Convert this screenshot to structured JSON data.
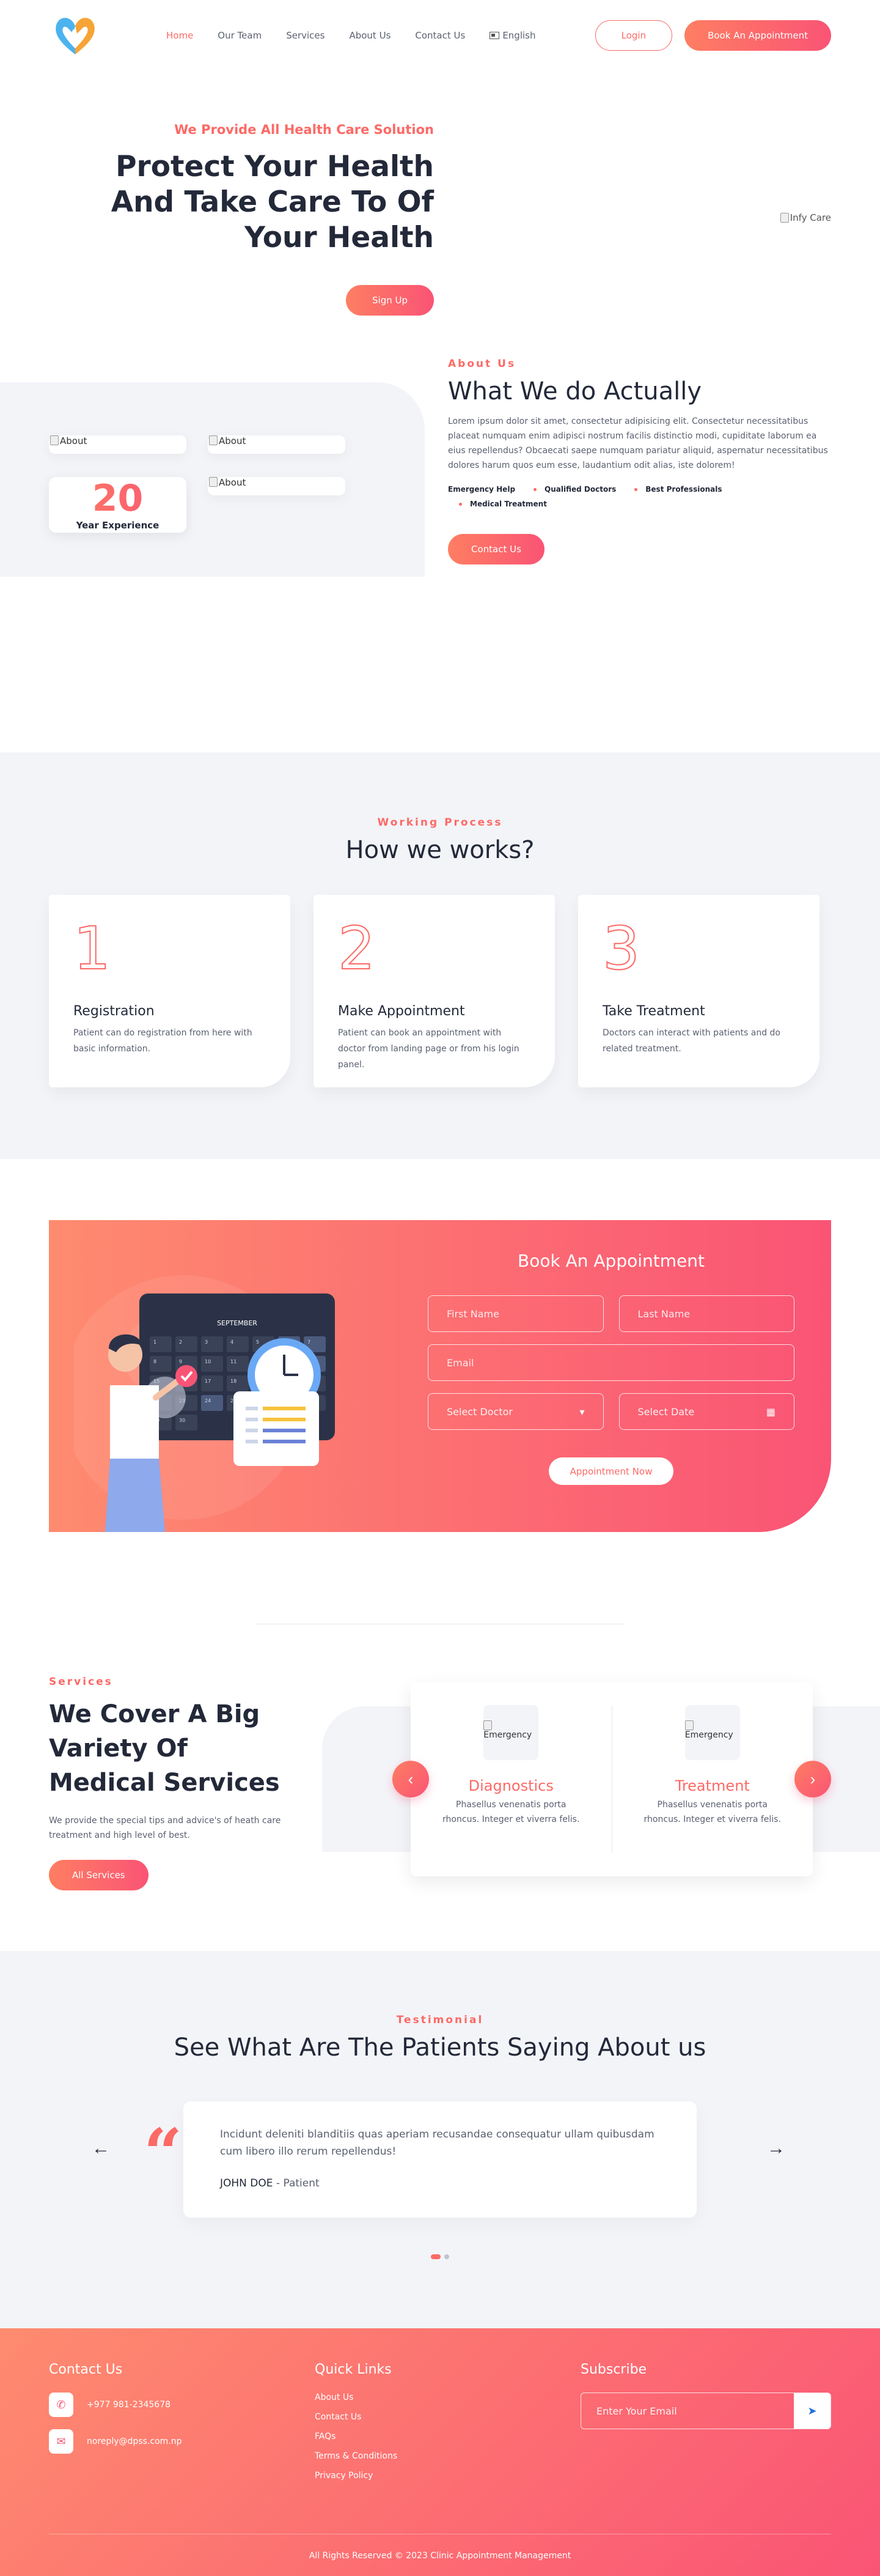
{
  "header": {
    "nav": [
      "Home",
      "Our Team",
      "Services",
      "About Us",
      "Contact Us"
    ],
    "language": "English",
    "login_label": "Login",
    "book_label": "Book An Appointment",
    "colors": {
      "accent": "#fc6a66",
      "gradient_start": "#fe7e62",
      "gradient_end": "#fa5475",
      "logo_blue": "#4cb3ef",
      "logo_orange": "#f7a437"
    }
  },
  "hero": {
    "subtitle": "We Provide All Health Care Solution",
    "title": "Protect Your Health And Take Care To Of Your Health",
    "signup_label": "Sign Up",
    "image_alt": "Infy Care"
  },
  "about": {
    "image_alt_1": "About",
    "image_alt_2": "About",
    "image_alt_3": "About",
    "experience_number": "20",
    "experience_label": "Year Experience",
    "tagline": "About Us",
    "title": "What We do Actually",
    "paragraph": "Lorem ipsum dolor sit amet, consectetur adipisicing elit. Consectetur necessitatibus placeat numquam enim adipisci nostrum facilis distinctio modi, cupiditate laborum ea eius repellendus? Obcaecati saepe numquam pariatur aliquid, aspernatur necessitatibus dolores harum quos eum esse, laudantium odit alias, iste dolorem!",
    "features": [
      "Emergency Help",
      "Qualified Doctors",
      "Best Professionals",
      "Medical Treatment"
    ],
    "contact_label": "Contact Us"
  },
  "works": {
    "tagline": "Working Process",
    "title": "How we works?",
    "steps": [
      {
        "num": "1",
        "title": "Registration",
        "desc": "Patient can do registration from here with basic information."
      },
      {
        "num": "2",
        "title": "Make Appointment",
        "desc": "Patient can book an appointment with doctor from landing page or from his login panel."
      },
      {
        "num": "3",
        "title": "Take Treatment",
        "desc": "Doctors can interact with patients and do related treatment."
      }
    ]
  },
  "appointment": {
    "title": "Book An Appointment",
    "first_name_placeholder": "First Name",
    "last_name_placeholder": "Last Name",
    "email_placeholder": "Email",
    "doctor_label": "Select Doctor",
    "date_label": "Select Date",
    "submit_label": "Appointment Now",
    "calendar_month": "SEPTEMBER",
    "calendar_days": [
      "1",
      "2",
      "3",
      "4",
      "5",
      "6",
      "7",
      "8",
      "9",
      "10",
      "11",
      "12",
      "13",
      "14",
      "15",
      "16",
      "17",
      "18",
      "19",
      "20",
      "21",
      "22",
      "23",
      "24",
      "25",
      "26",
      "27",
      "28",
      "29",
      "30"
    ]
  },
  "services": {
    "tagline": "Services",
    "title": "We Cover A Big Variety Of Medical Services",
    "paragraph": "We provide the special tips and advice's of heath care treatment and high level of best.",
    "all_label": "All Services",
    "items": [
      {
        "icon_alt": "Emergency",
        "title": "Diagnostics",
        "desc": "Phasellus venenatis porta rhoncus. Integer et viverra felis."
      },
      {
        "icon_alt": "Emergency",
        "title": "Treatment",
        "desc": "Phasellus venenatis porta rhoncus. Integer et viverra felis."
      }
    ],
    "prev_icon": "‹",
    "next_icon": "›"
  },
  "testimonial": {
    "tagline": "Testimonial",
    "title": "See What Are The Patients Saying About us",
    "quote": "Incidunt deleniti blanditiis quas aperiam recusandae consequatur ullam quibusdam cum libero illo rerum repellendus!",
    "author": "JOHN DOE",
    "role": "- Patient",
    "prev_icon": "←",
    "next_icon": "→"
  },
  "footer": {
    "contact_title": "Contact Us",
    "phone": "+977 981-2345678",
    "email": "noreply@dpss.com.np",
    "links_title": "Quick Links",
    "links": [
      "About Us",
      "Contact Us",
      "FAQs",
      "Terms & Conditions",
      "Privacy Policy"
    ],
    "subscribe_title": "Subscribe",
    "subscribe_placeholder": "Enter Your Email",
    "copyright": "All Rights Reserved © 2023 Clinic Appointment Management"
  }
}
